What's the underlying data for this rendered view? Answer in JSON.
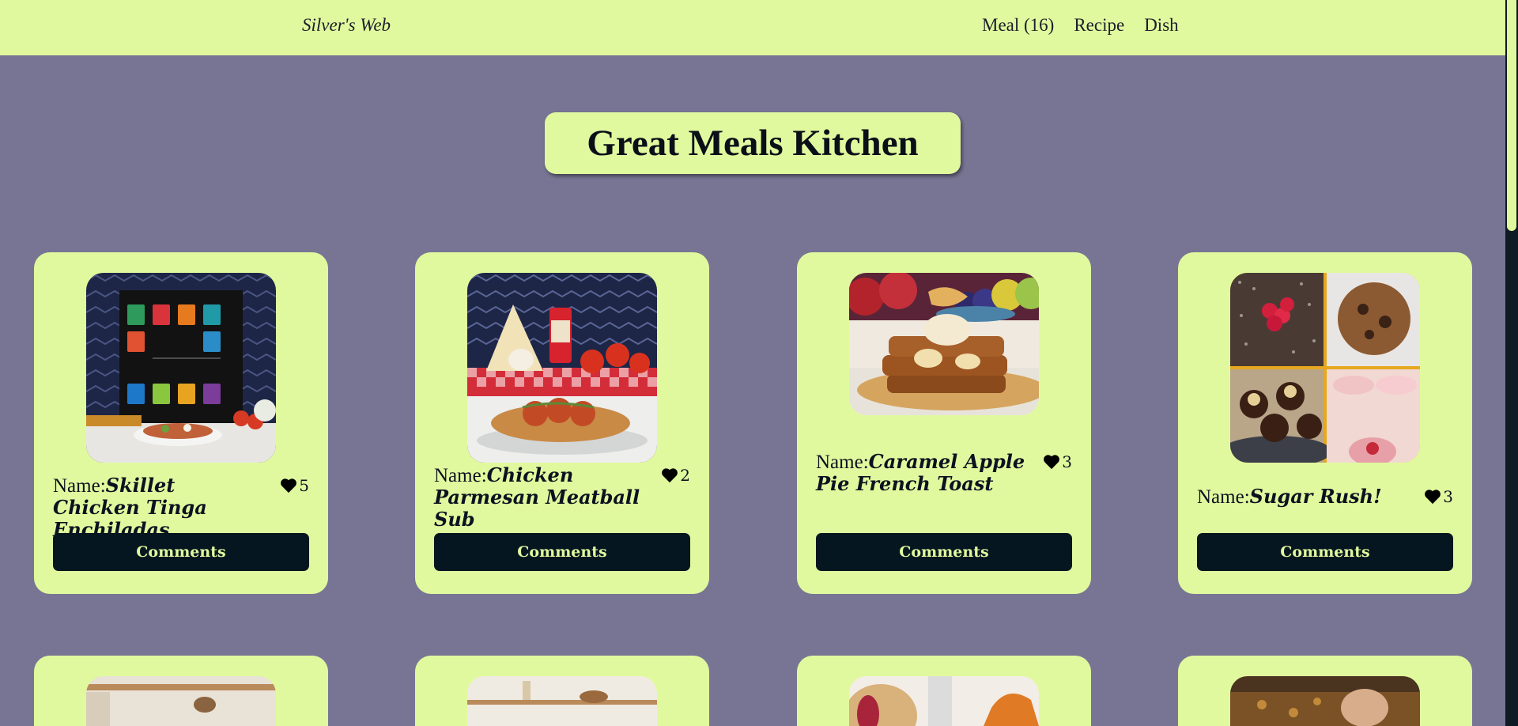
{
  "brand": "Silver's Web",
  "nav": [
    {
      "label": "Meal (16)"
    },
    {
      "label": "Recipe"
    },
    {
      "label": "Dish"
    }
  ],
  "hero_title": "Great Meals Kitchen",
  "name_label": "Name:",
  "comments_label": "Comments",
  "cards": [
    {
      "name": "Skillet Chicken Tinga Enchiladas",
      "likes": "5",
      "image_icon": "spice-set-enchilada-photo"
    },
    {
      "name": "Chicken Parmesan Meatball Sub",
      "likes": "2",
      "image_icon": "meatball-sub-photo"
    },
    {
      "name": "Caramel Apple Pie French Toast",
      "likes": "3",
      "image_icon": "french-toast-photo"
    },
    {
      "name": "Sugar Rush!",
      "likes": "3",
      "image_icon": "dessert-collage-photo"
    }
  ],
  "colors": {
    "accent": "#e1f99e",
    "background": "#787594",
    "button": "#061620"
  }
}
